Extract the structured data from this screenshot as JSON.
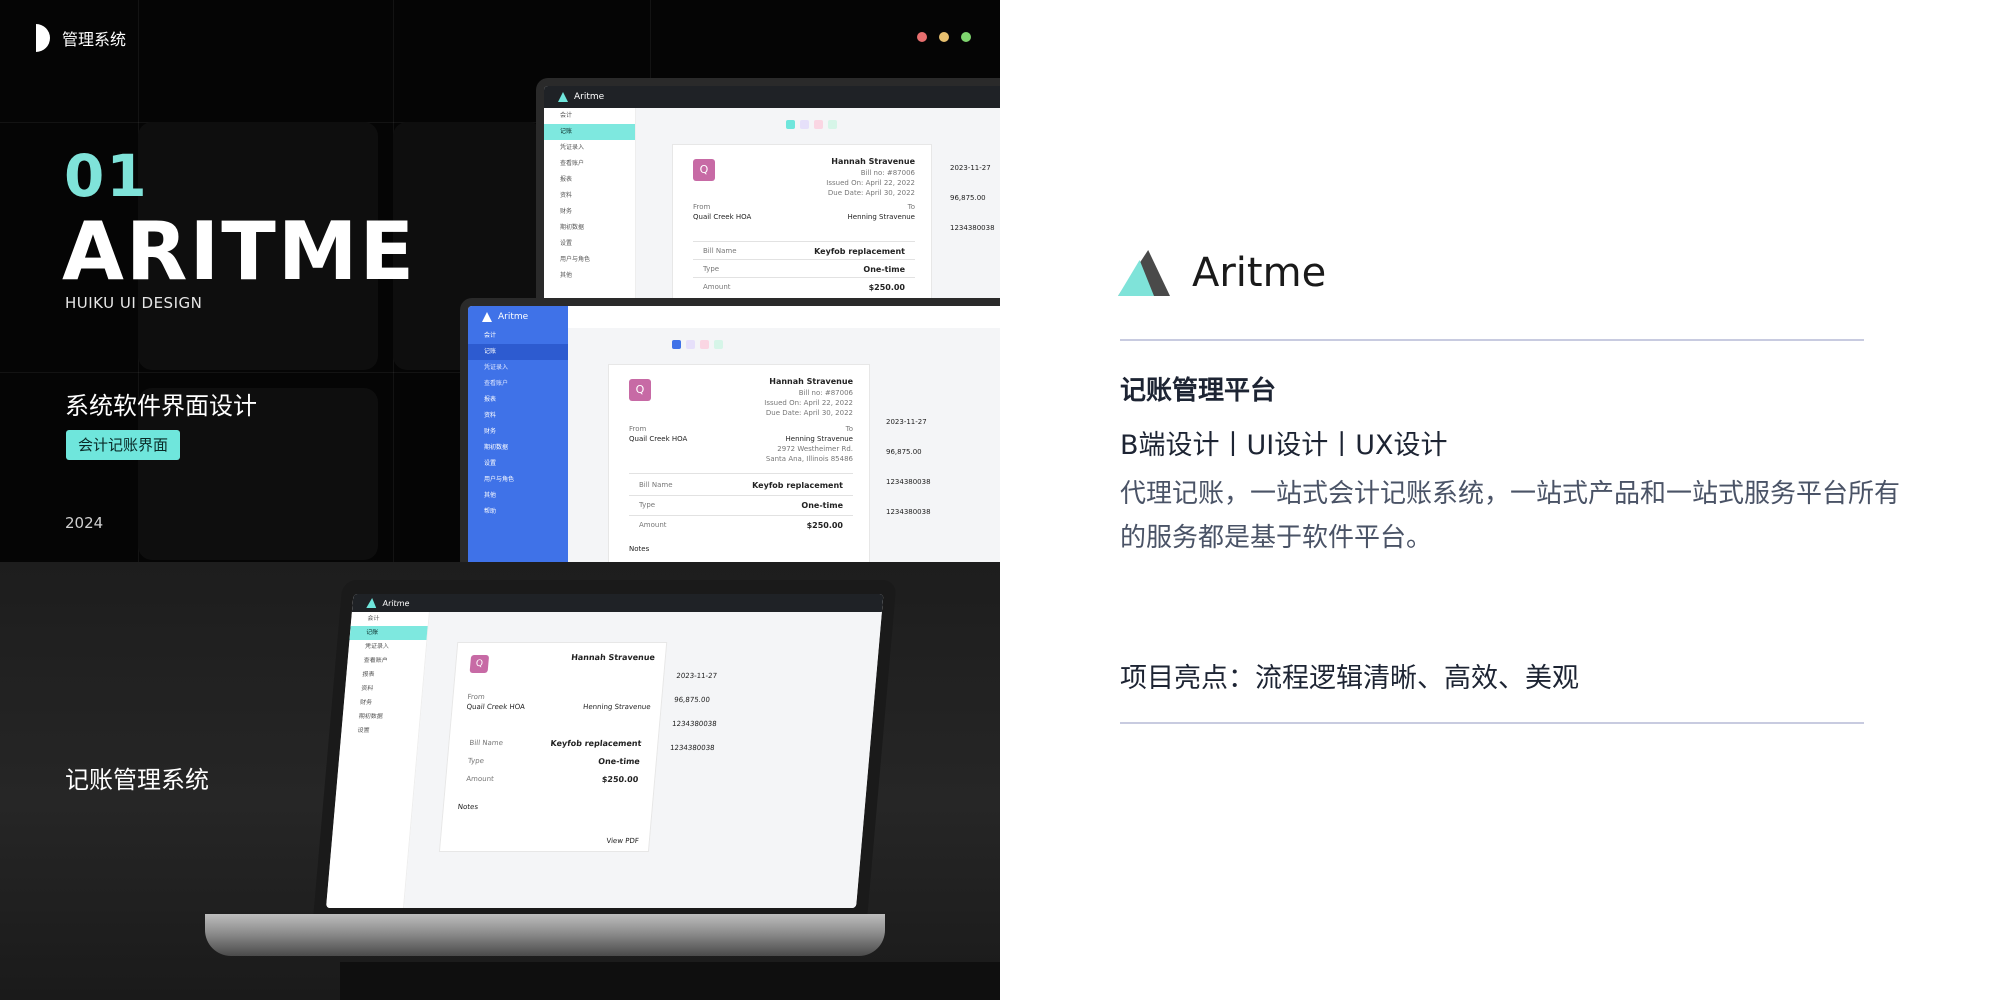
{
  "left": {
    "brand": {
      "text": "管理系统"
    },
    "number": "01",
    "hero_title": "ARITME",
    "hero_subtitle": "HUIKU UI DESIGN",
    "system_title": "系统软件界面设计",
    "badge": "会计记账界面",
    "year": "2024",
    "system_name": "记账管理系统",
    "window_dots": [
      "#e86f6f",
      "#e8c06f",
      "#7fd66f"
    ],
    "mockup": {
      "app_name": "Aritme",
      "sidebar_items": [
        "会计",
        "记账",
        "凭证录入",
        "查看账户",
        "报表",
        "资料",
        "财务",
        "期初数据",
        "设置",
        "用户与角色",
        "其他",
        "帮助"
      ],
      "invoice": {
        "badge_letter": "Q",
        "customer": "Hannah Stravenue",
        "bill_no": "Bill no: #87006",
        "issued": "Issued On: April 22, 2022",
        "due": "Due Date: April 30, 2022",
        "from_label": "From",
        "from_name": "Quail Creek HOA",
        "to_label": "To",
        "to_name": "Henning Stravenue",
        "to_address_1": "2972 Westheimer Rd.",
        "to_address_2": "Santa Ana, Illinois 85486",
        "bill_name_label": "Bill Name",
        "bill_name_value": "Keyfob replacement",
        "type_label": "Type",
        "type_value": "One-time",
        "amount_label": "Amount",
        "amount_value": "$250.00",
        "notes_label": "Notes",
        "view_pdf": "View PDF"
      },
      "form": {
        "date_value": "2023-11-27",
        "amount_value": "96,875.00",
        "account_1": "1234380038",
        "account_2": "1234380038"
      }
    }
  },
  "right": {
    "logo_text": "Aritme",
    "title": "记账管理平台",
    "tags": "B端设计丨UI设计丨UX设计",
    "description": "代理记账，一站式会计记账系统，一站式产品和一站式服务平台所有的服务都是基于软件平台。",
    "highlights": "项目亮点：流程逻辑清晰、高效、美观"
  }
}
